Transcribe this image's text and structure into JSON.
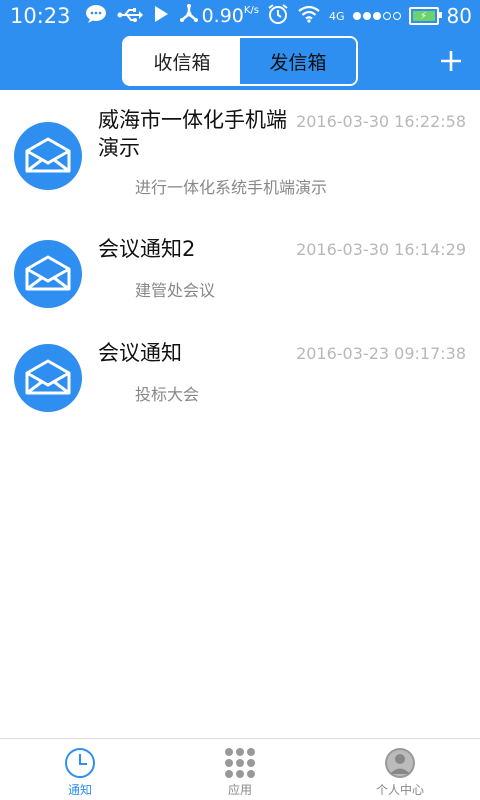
{
  "status_bar": {
    "time": "10:23",
    "speed_value": "0.90",
    "speed_unit": "K/s",
    "network": "4G",
    "battery": "80"
  },
  "header": {
    "tabs": [
      {
        "label": "收信箱"
      },
      {
        "label": "发信箱"
      }
    ]
  },
  "messages": [
    {
      "title": "威海市一体化手机端演示",
      "time": "2016-03-30 16:22:58",
      "subtitle": "进行一体化系统手机端演示"
    },
    {
      "title": "会议通知2",
      "time": "2016-03-30 16:14:29",
      "subtitle": "建管处会议"
    },
    {
      "title": "会议通知",
      "time": "2016-03-23 09:17:38",
      "subtitle": "投标大会"
    }
  ],
  "bottom_nav": [
    {
      "label": "通知",
      "icon": "clock-icon"
    },
    {
      "label": "应用",
      "icon": "apps-grid-icon"
    },
    {
      "label": "个人中心",
      "icon": "person-icon"
    }
  ],
  "colors": {
    "accent": "#2e8ff0",
    "battery_fill": "#6cd36c"
  }
}
